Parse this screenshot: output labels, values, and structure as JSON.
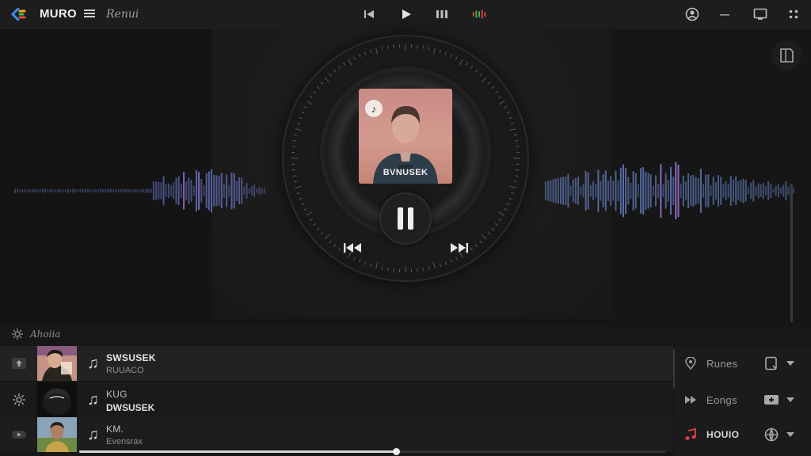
{
  "app": {
    "brand": "MURO",
    "menu_label": "Renui"
  },
  "titlebar": {
    "prev_icon": "skip-previous-icon",
    "play_icon": "play-icon",
    "pause_icon": "pause-icon",
    "audio_icon": "audio-indicator-icon",
    "account_icon": "account-icon",
    "minimize_icon": "minimize-icon",
    "window_icon": "window-icon",
    "more_icon": "more-grid-icon"
  },
  "now_playing": {
    "cover_caption": "BVNUSEK",
    "cover_badge_icon": "music-note-icon",
    "colors": {
      "cover_top": "#c98b86",
      "cover_bottom": "#c48578",
      "wave_left": "#5a67a8",
      "wave_right": "#5d78b5",
      "wave_accent": "#8f6ec9"
    }
  },
  "section": {
    "title": "Ahoiia",
    "icon": "gear-icon"
  },
  "songs": [
    {
      "line1": "SWSUSEK",
      "line2": "RUUACO",
      "icon": "upload-icon",
      "note_icon": "music-note-icon",
      "line1_light": false
    },
    {
      "line1": "KUG",
      "line2": "DWSUSEK",
      "icon": "settings-icon",
      "note_icon": "music-note-icon",
      "line1_light": true
    },
    {
      "line1": "KM.",
      "line2": "Evensrax",
      "icon": "video-icon",
      "note_icon": "music-note-icon",
      "line1_light": true
    }
  ],
  "playback": {
    "progress": 0.54
  },
  "side_panel": [
    {
      "label": "Runes",
      "icon": "location-pin-icon",
      "action_icon": "document-icon",
      "active": false
    },
    {
      "label": "Eongs",
      "icon": "fast-forward-icon",
      "action_icon": "add-to-queue-icon",
      "active": false
    },
    {
      "label": "HOUIO",
      "icon": "music-note-icon",
      "action_icon": "globe-icon",
      "active": true,
      "accent": "#e0404a"
    }
  ]
}
